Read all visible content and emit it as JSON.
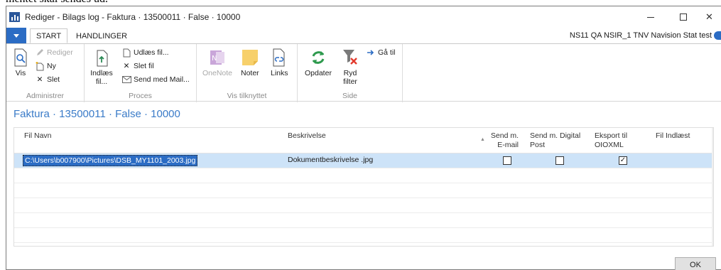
{
  "cropped_top_text": "mentet skal sendes ud.",
  "window": {
    "title": "Rediger - Bilags log - Faktura · 13500011 · False · 10000"
  },
  "tabs": [
    {
      "label": "START"
    },
    {
      "label": "HANDLINGER"
    }
  ],
  "company": "NS11 QA NSIR_1 TNV Navision Stat test",
  "ribbon": {
    "groups": [
      {
        "label": "Administrer"
      },
      {
        "label": "Proces"
      },
      {
        "label": "Vis tilknyttet"
      },
      {
        "label": "Side"
      }
    ],
    "buttons": {
      "vis": "Vis",
      "rediger": "Rediger",
      "ny": "Ny",
      "slet": "Slet",
      "indlaes_fil": "Indlæs fil...",
      "udlaes_fil": "Udlæs fil...",
      "slet_fil": "Slet fil",
      "send_med_mail": "Send med Mail...",
      "onenote": "OneNote",
      "noter": "Noter",
      "links": "Links",
      "opdater": "Opdater",
      "ryd_filter": "Ryd filter",
      "gaa_til": "Gå til"
    }
  },
  "page_title": "Faktura · 13500011 · False · 10000",
  "grid": {
    "columns": [
      "Fil Navn",
      "Beskrivelse",
      "Send m. E-mail",
      "Send m. Digital Post",
      "Eksport til OIOXML",
      "Fil Indlæst"
    ],
    "rows": [
      {
        "fil_navn": "C:\\Users\\b007900\\Pictures\\DSB_MY1101_2003.jpg",
        "beskrivelse": "Dokumentbeskrivelse .jpg",
        "send_email": false,
        "send_digital_post": false,
        "eksport_oioxml": true,
        "fil_indlaest": ""
      }
    ]
  },
  "ok_label": "OK",
  "colors": {
    "accent": "#2b6cc4",
    "title_blue": "#3a7bc8",
    "selected_row": "#cde3f8"
  }
}
